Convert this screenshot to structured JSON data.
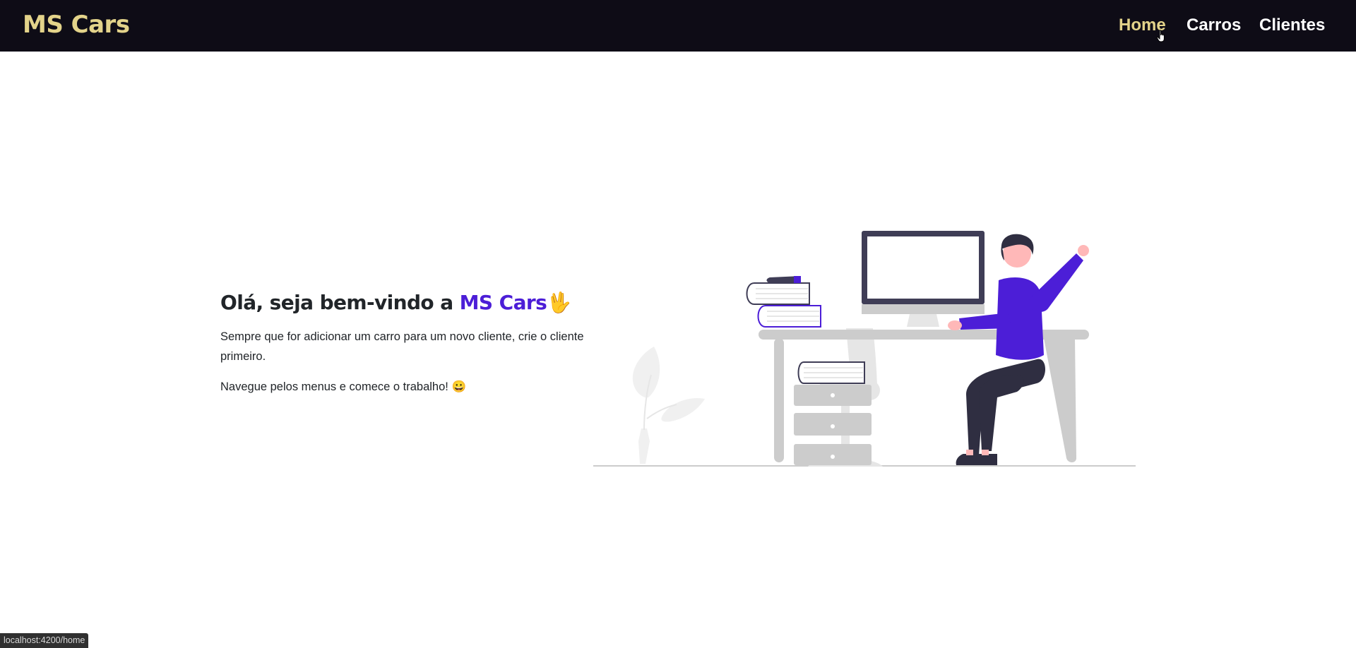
{
  "navbar": {
    "brand": "MS Cars",
    "links": [
      {
        "label": "Home",
        "active": true
      },
      {
        "label": "Carros",
        "active": false
      },
      {
        "label": "Clientes",
        "active": false
      }
    ]
  },
  "hero": {
    "title_prefix": "Olá, seja bem-vindo a ",
    "title_brand": "MS Cars",
    "title_emoji": "🖖",
    "paragraph1": "Sempre que for adicionar um carro para um novo cliente, crie o cliente primeiro.",
    "paragraph2": "Navegue pelos menus e comece o trabalho! 😀"
  },
  "status_bar": {
    "url": "localhost:4200/home"
  },
  "colors": {
    "navbar_bg": "#0e0c16",
    "brand": "#e3d38a",
    "accent": "#4c1ed7",
    "text": "#212529"
  }
}
